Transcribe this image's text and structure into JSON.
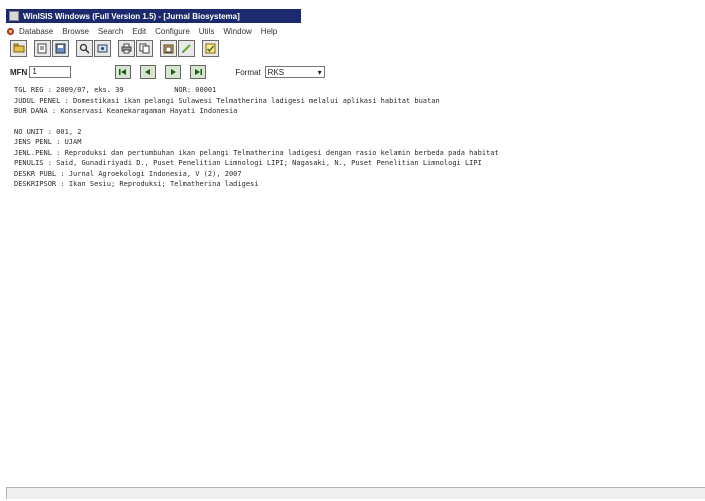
{
  "window": {
    "title": "WinISIS Windows (Full Version 1.5) - [Jurnal Biosystema]"
  },
  "menu": [
    "Database",
    "Browse",
    "Search",
    "Edit",
    "Configure",
    "Utils",
    "Window",
    "Help"
  ],
  "toolbar": {
    "icons": [
      "open-db-icon",
      "open-icon",
      "save-icon",
      "search-icon",
      "search-guided-icon",
      "print-icon",
      "copy-icon",
      "paste-icon",
      "edit-icon",
      "display-icon"
    ]
  },
  "nav": {
    "mfn_label": "MFN",
    "mfn_value": "1",
    "format_label": "Format",
    "format_value": "RKS"
  },
  "record": [
    {
      "field": "TGL REG",
      "value": "2009/07, eks. 39",
      "extra": "NOR: 00001"
    },
    {
      "field": "JUDUL PENEL",
      "value": "Domestikasi ikan pelangi Sulawesi Telmatherina ladigesi melalui aplikasi habitat buatan"
    },
    {
      "field": "BUR DANA",
      "value": "Konservasi Keanekaragaman Hayati Indonesia"
    },
    {
      "field": "NO UNIT",
      "value": "001, 2"
    },
    {
      "field": "JENS PENL",
      "value": "UJAM"
    },
    {
      "field": "JENL.PENL",
      "value": "Reproduksi dan pertumbuhan ikan pelangi Telmatherina ladigesi dengan rasio kelamin berbeda pada habitat"
    },
    {
      "field": "PENULIS",
      "value": "Said, Gunadiriyadi D., Puset Penelitian Limnologi LIPI; Nagasaki, N., Puset Penelitian Limnologi LIPI"
    },
    {
      "field": "DESKR PUBL",
      "value": "Jurnal Agroekologi Indonesia, V (2), 2007"
    },
    {
      "field": "DESKRIPSOR",
      "value": "Ikan Sesiu; Reproduksi; Telmatherina ladigesi"
    }
  ],
  "colors": {
    "titlebar": "#1a2a6c",
    "nav_button": "#d7e7cf"
  }
}
